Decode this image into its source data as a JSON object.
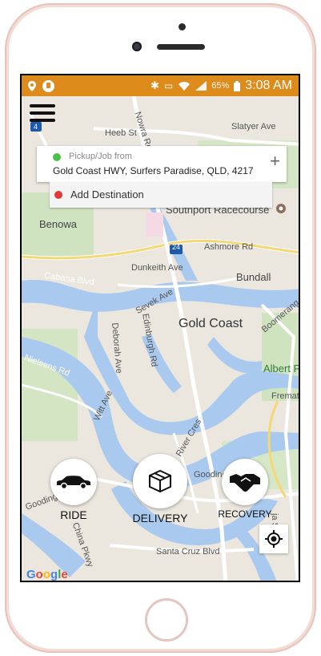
{
  "status_bar": {
    "battery_percent": "65%",
    "time": "3:08 AM",
    "icons": [
      "location-pin-icon",
      "app-notification-icon",
      "bluetooth-icon",
      "vibrate-mute-icon",
      "wifi-icon",
      "signal-icon",
      "battery-icon"
    ]
  },
  "map": {
    "labels": {
      "heeb_st": "Heeb St",
      "nowra_rd": "Nowra Rd",
      "slatyer_ave": "Slatyer Ave",
      "southport_racecourse": "Southport Racecourse",
      "benowa": "Benowa",
      "ashmore_rd": "Ashmore Rd",
      "route_24": "24",
      "route_4": "4",
      "dunkeith_ave": "Dunkeith Ave",
      "bundall": "Bundall",
      "cabana_blvd": "Cabana Blvd",
      "sevek_ave": "Sevek Ave",
      "edinburgh_rd": "Edinburgh Rd",
      "deborah_ave": "Deborah Ave",
      "gold_coast": "Gold Coast",
      "boomerang_cres": "Boomerang Cres",
      "albert_pa": "Albert Pa",
      "nielsens_rd": "Nielsens Rd",
      "witt_ave": "Witt Ave",
      "fremat": "Fremat",
      "river_cres": "River Cres",
      "gooding_broadbe": "Gooding Broadbe",
      "china_pkwy": "China Pkwy",
      "santa_cruz_blvd": "Santa Cruz Blvd",
      "ja_st": "ja St"
    },
    "google_logo": [
      "G",
      "o",
      "o",
      "g",
      "l",
      "e"
    ]
  },
  "trip": {
    "pickup_label": "Pickup/Job from",
    "pickup_address": "Gold Coast HWY, Surfers Paradise, QLD, 4217",
    "add_destination": "Add Destination"
  },
  "services": {
    "ride": "RIDE",
    "delivery": "DELIVERY",
    "recovery": "RECOVERY"
  },
  "colors": {
    "status_bar": "#dd8b1b",
    "pickup_dot": "#4cc14a",
    "destination_dot": "#e03b36",
    "water": "#a9c9ef"
  }
}
